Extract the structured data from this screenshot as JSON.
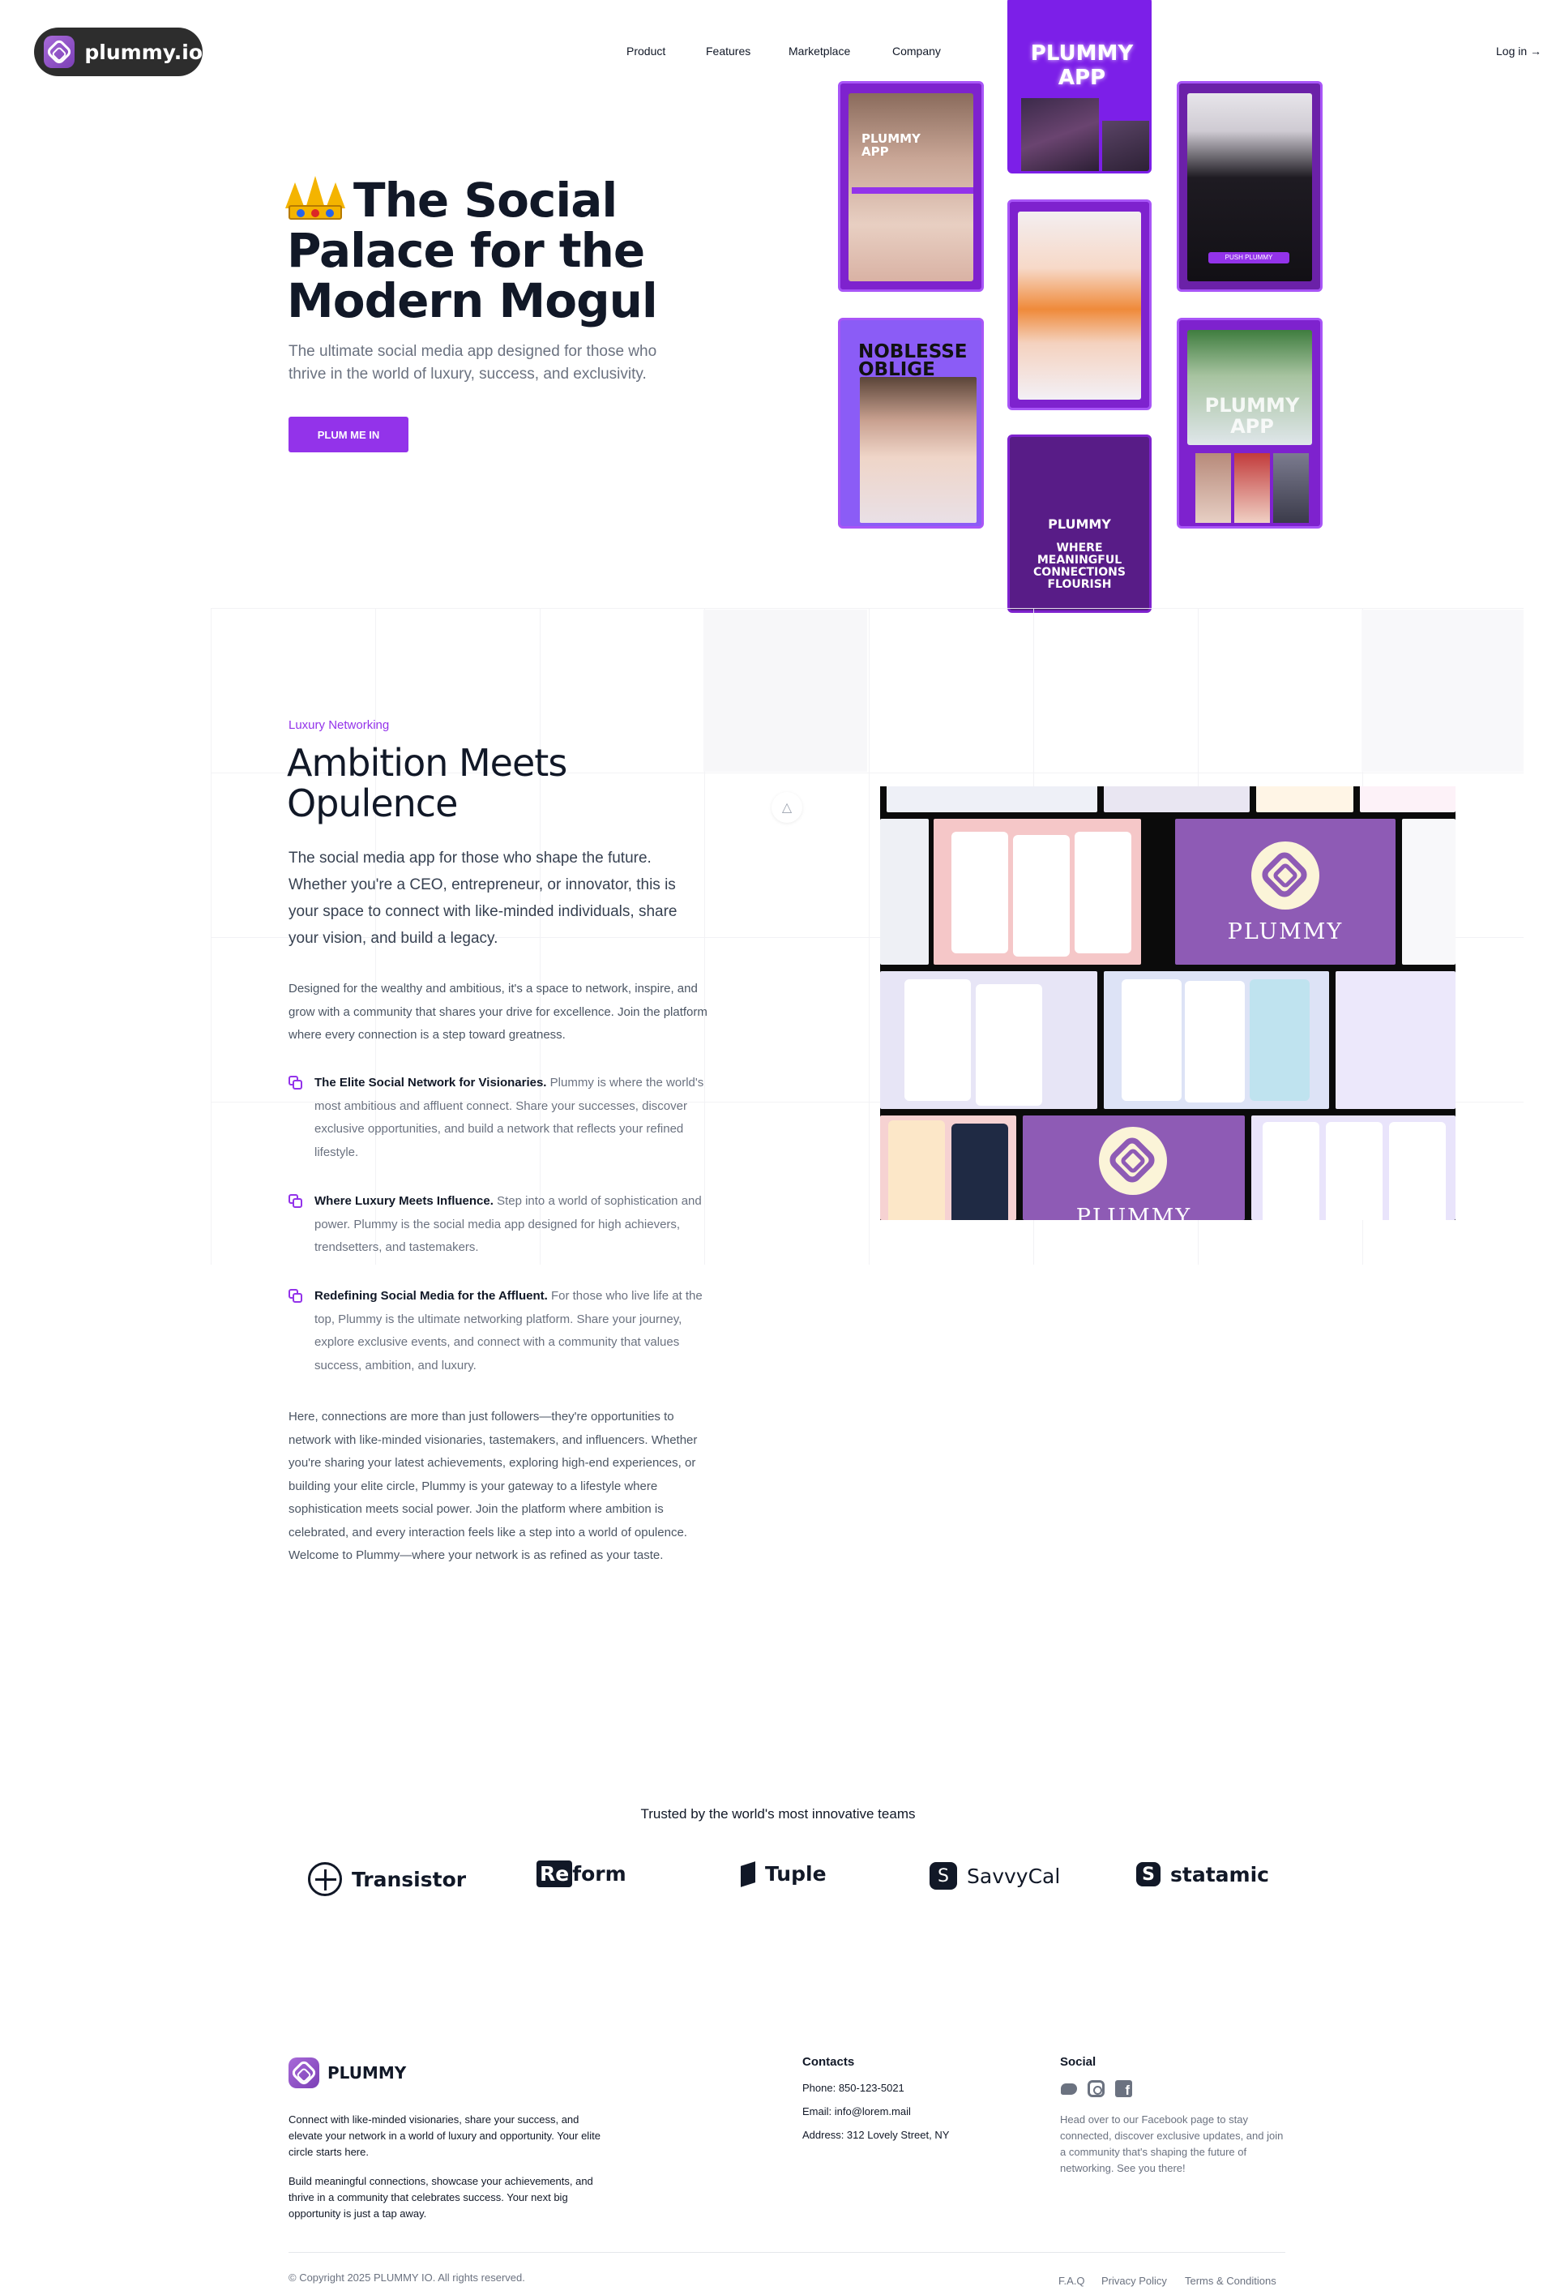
{
  "header": {
    "brand": "plummy.io",
    "nav": [
      "Product",
      "Features",
      "Marketplace",
      "Company"
    ],
    "login": "Log in →"
  },
  "hero": {
    "title": "The Social Palace for the Modern Mogul",
    "subtitle": "The ultimate social media app designed for those who thrive in the world of luxury, success, and exclusivity.",
    "cta": "PLUM ME IN",
    "cards": {
      "c1": "PLUMMY APP",
      "c2": "PLUMMY APP",
      "c3": "NOBLESSE OBLIGE",
      "c4_top": "PLUMMY",
      "c4_bottom": "WHERE MEANINGFUL CONNECTIONS FLOURISH",
      "c5": "PLUMMY APP",
      "c6_button": "PUSH PLUMMY"
    }
  },
  "section2": {
    "eyebrow": "Luxury Networking",
    "title": "Ambition Meets Opulence",
    "lead": "The social media app for those who shape the future. Whether you're a CEO, entrepreneur, or innovator, this is your space to connect with like-minded individuals, share your vision, and build a legacy.",
    "intro": "Designed for the wealthy and ambitious, it's a space to network, inspire, and grow with a community that shares your drive for excellence. Join the platform where every connection is a step toward greatness.",
    "features": [
      {
        "title": "The Elite Social Network for Visionaries.",
        "text": "Plummy is where the world's most ambitious and affluent connect. Share your successes, discover exclusive opportunities, and build a network that reflects your refined lifestyle."
      },
      {
        "title": "Where Luxury Meets Influence.",
        "text": "Step into a world of sophistication and power. Plummy is the social media app designed for high achievers, trendsetters, and tastemakers."
      },
      {
        "title": "Redefining Social Media for the Affluent.",
        "text": "For those who live life at the top, Plummy is the ultimate networking platform. Share your journey, explore exclusive events, and connect with a community that values success, ambition, and luxury."
      }
    ],
    "closing": "Here, connections are more than just followers—they're opportunities to network with like-minded visionaries, tastemakers, and influencers. Whether you're sharing your latest achievements, exploring high-end experiences, or building your elite circle, Plummy is your gateway to a lifestyle where sophistication meets social power. Join the platform where ambition is celebrated, and every interaction feels like a step into a world of opulence. Welcome to Plummy—where your network is as refined as your taste.",
    "collage": {
      "word": "PLUMMY",
      "word2": "PLUMMY"
    }
  },
  "trusted": {
    "heading": "Trusted by the world's most innovative teams",
    "brands": [
      "Transistor",
      "Reform",
      "Tuple",
      "SavvyCal",
      "statamic"
    ]
  },
  "footer": {
    "brand": "PLUMMY",
    "p1": "Connect with like-minded visionaries, share your success, and elevate your network in a world of luxury and opportunity. Your elite circle starts here.",
    "p2": "Build meaningful connections, showcase your achievements, and thrive in a community that celebrates success. Your next big opportunity is just a tap away.",
    "contacts_heading": "Contacts",
    "phone": "Phone: 850-123-5021",
    "email": "Email: info@lorem.mail",
    "address": "Address: 312 Lovely Street, NY",
    "social_heading": "Social",
    "social_icons": [
      "twitter-icon",
      "instagram-icon",
      "facebook-icon"
    ],
    "social_text": "Head over to our Facebook page to stay connected, discover exclusive updates, and join a community that's shaping the future of networking. See you there!",
    "copyright": "© Copyright 2025 PLUMMY IO. All rights reserved.",
    "links": [
      "F.A.Q",
      "Privacy Policy",
      "Terms & Conditions"
    ]
  },
  "colors": {
    "accent": "#9333ea",
    "card_purple": "#7e22ce",
    "logo_pill": "#2d2d2d"
  }
}
